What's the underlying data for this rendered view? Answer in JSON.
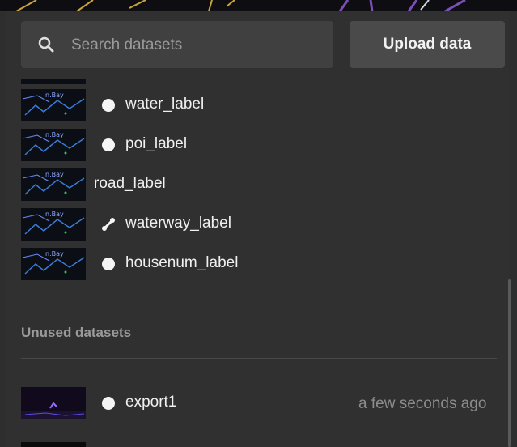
{
  "search": {
    "placeholder": "Search datasets",
    "value": ""
  },
  "upload_button": {
    "label": "Upload data"
  },
  "datasets": [
    {
      "name": "",
      "icon": "circle-icon",
      "tag_color": "#b8b840"
    },
    {
      "name": "water_label",
      "icon": "circle-icon",
      "tag_color": "#9fd6c6"
    },
    {
      "name": "poi_label",
      "icon": "circle-icon",
      "tag_color": "#7b59c9"
    },
    {
      "name": "road_label",
      "icon": "none",
      "tag_color": "#6fc2c4"
    },
    {
      "name": "waterway_label",
      "icon": "line-icon",
      "tag_color": "#9fd6c6"
    },
    {
      "name": "housenum_label",
      "icon": "circle-icon",
      "tag_color": "#d98a52"
    }
  ],
  "unused_section": {
    "title": "Unused datasets"
  },
  "unused_datasets": [
    {
      "name": "export1",
      "icon": "circle-icon",
      "time": "a few seconds ago",
      "tag_color": "#79c98d"
    }
  ]
}
